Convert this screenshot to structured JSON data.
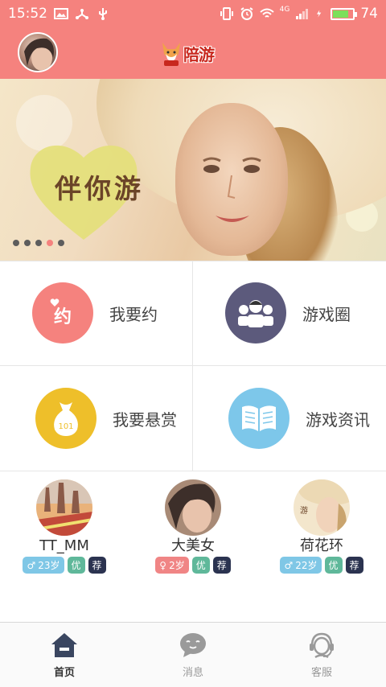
{
  "status_bar": {
    "time": "15:52",
    "network": "4G",
    "battery": "74",
    "icons": [
      "image-icon",
      "share-icon",
      "usb-icon",
      "vibrate-icon",
      "alarm-icon",
      "wifi-icon",
      "signal-icon",
      "charging-icon",
      "battery-icon"
    ]
  },
  "header": {
    "logo_text": "陪游",
    "avatar_icon": "user-avatar"
  },
  "banner": {
    "slogan": "伴你游",
    "slide_count": 5,
    "active_slide": 4
  },
  "features": [
    {
      "label": "我要约",
      "icon": "date-icon",
      "color": "#f5827e"
    },
    {
      "label": "游戏圈",
      "icon": "group-icon",
      "color": "#5c5a7c"
    },
    {
      "label": "我要悬赏",
      "icon": "money-bag-icon",
      "color": "#eebf2a"
    },
    {
      "label": "游戏资讯",
      "icon": "book-icon",
      "color": "#7dc7ea"
    }
  ],
  "users": [
    {
      "name": "TT_MM",
      "gender": "male",
      "age": "23岁",
      "tag_you": "优",
      "tag_jian": "荐"
    },
    {
      "name": "大美女",
      "gender": "female",
      "age": "2岁",
      "tag_you": "优",
      "tag_jian": "荐"
    },
    {
      "name": "荷花环",
      "gender": "male",
      "age": "22岁",
      "tag_you": "优",
      "tag_jian": "荐"
    }
  ],
  "nav": [
    {
      "label": "首页",
      "icon": "home-icon",
      "active": true
    },
    {
      "label": "消息",
      "icon": "chat-icon",
      "active": false
    },
    {
      "label": "客服",
      "icon": "headset-icon",
      "active": false
    }
  ],
  "colors": {
    "brand": "#f5827e",
    "male_tag": "#7fc7e6",
    "female_tag": "#f08585",
    "you_tag": "#5fb89a",
    "jian_tag": "#2b3350"
  }
}
